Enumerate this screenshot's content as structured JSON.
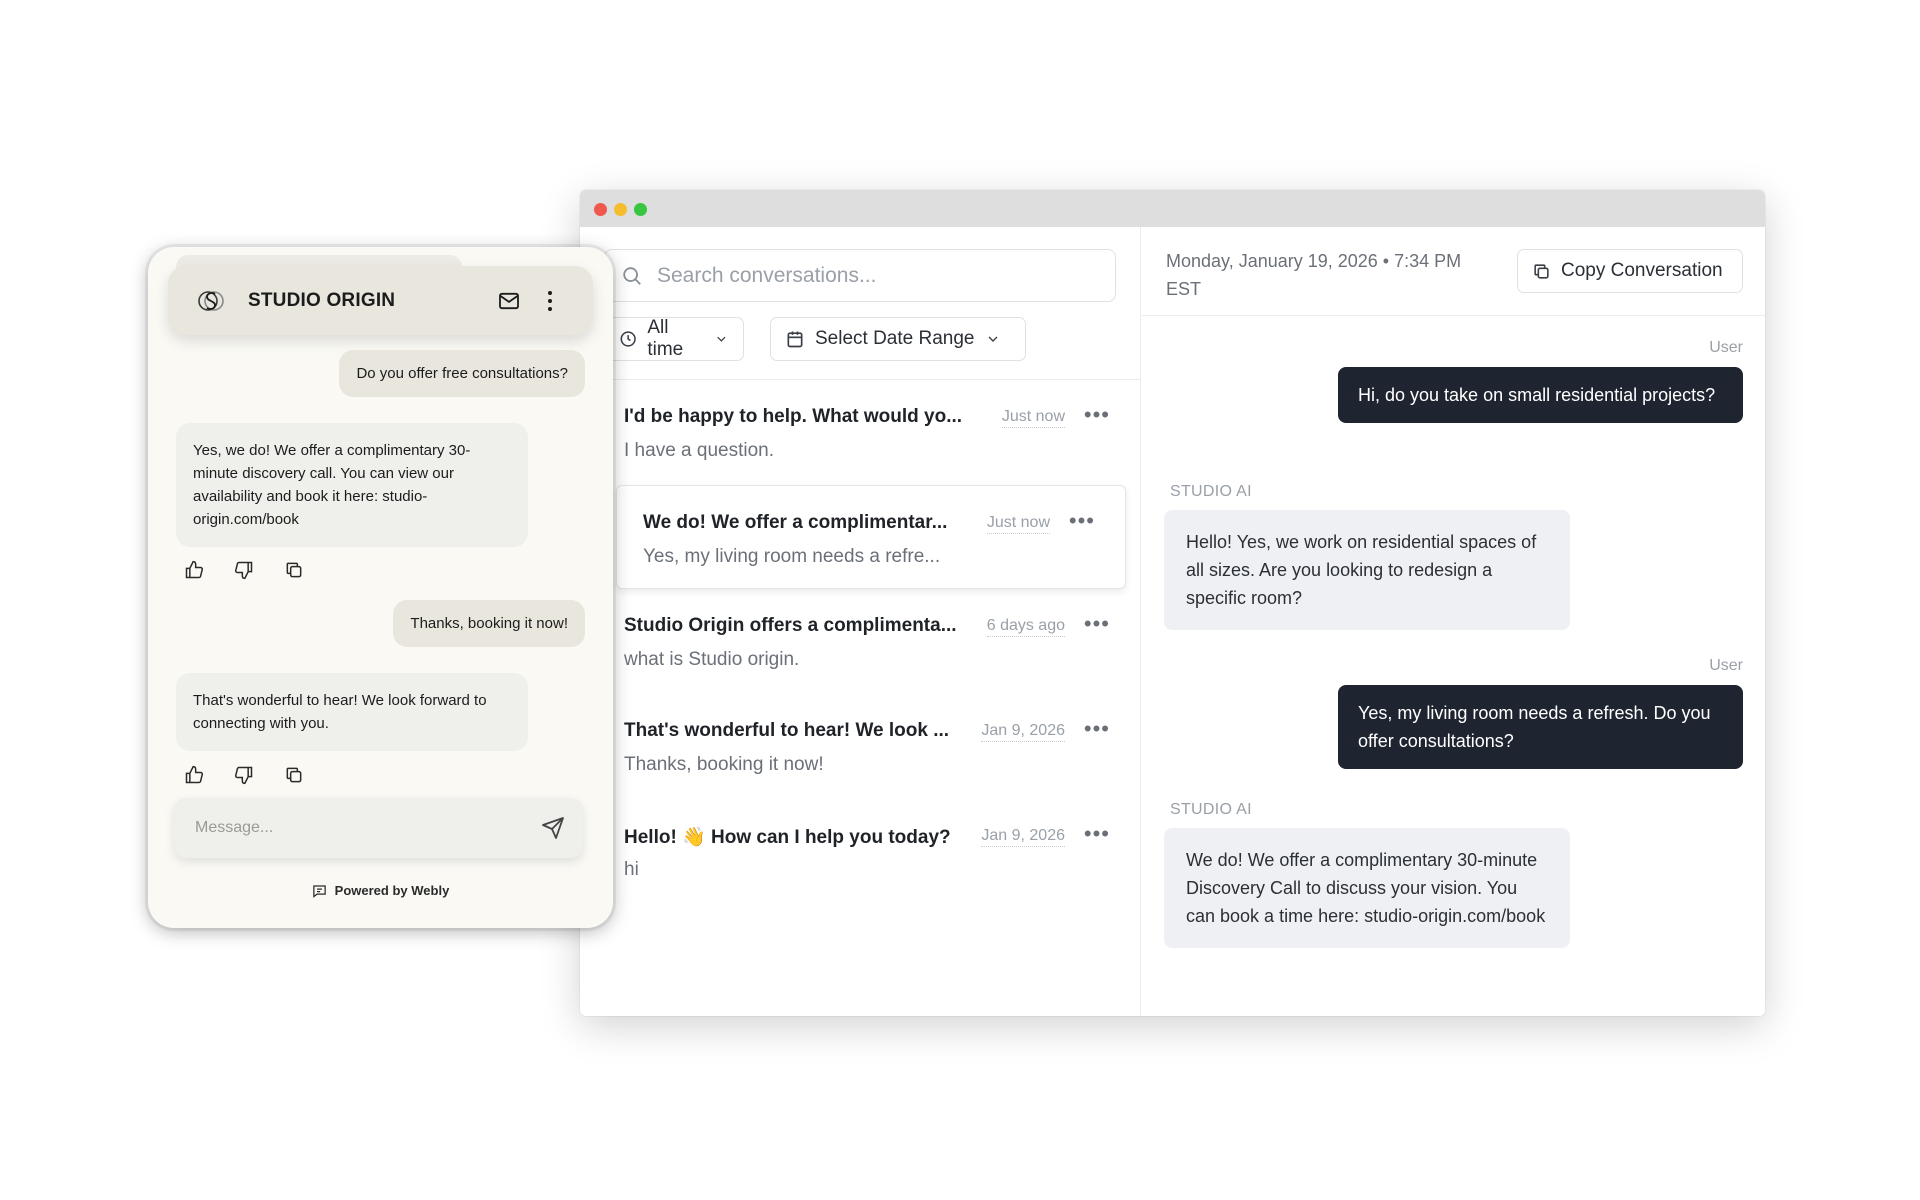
{
  "window": {
    "search": {
      "placeholder": "Search conversations..."
    },
    "filters": {
      "time_label": "All time",
      "date_range_label": "Select Date Range"
    },
    "conversations": [
      {
        "title": "I'd be happy to help. What would yo...",
        "preview": "I have a question.",
        "time": "Just now"
      },
      {
        "title": "We do! We offer a complimentar...",
        "preview": "Yes, my living room needs a refre...",
        "time": "Just now",
        "selected": true
      },
      {
        "title": "Studio Origin offers a complimenta...",
        "preview": "what is Studio origin.",
        "time": "6 days ago"
      },
      {
        "title": "That's wonderful to hear! We look ...",
        "preview": "Thanks, booking it now!",
        "time": "Jan 9, 2026"
      },
      {
        "title": "Hello! 👋 How can I help you today?",
        "preview": "hi",
        "time": "Jan 9, 2026"
      }
    ],
    "detail": {
      "date_line1": "Monday, January 19, 2026 • 7:34 PM",
      "date_line2": "EST",
      "copy_label": "Copy Conversation",
      "messages": [
        {
          "role": "User",
          "text": "Hi, do you take on small residential projects?"
        },
        {
          "role": "STUDIO AI",
          "text": "Hello! Yes, we work on residential spaces of all sizes. Are you looking to redesign a specific room?"
        },
        {
          "role": "User",
          "text": "Yes, my living room needs a refresh. Do you offer consultations?"
        },
        {
          "role": "STUDIO AI",
          "text": "We do! We offer a complimentary 30-minute Discovery Call to discuss your vision. You can book a time here: studio-origin.com/book"
        }
      ]
    }
  },
  "widget": {
    "brand": "STUDIO ORIGIN",
    "messages": [
      {
        "from": "user",
        "text": "Do you offer free consultations?"
      },
      {
        "from": "bot",
        "text": "Yes, we do! We offer a complimentary 30-minute discovery call. You can view our availability and book it here: studio-origin.com/book"
      },
      {
        "from": "user",
        "text": "Thanks, booking it now!"
      },
      {
        "from": "bot",
        "text": "That's wonderful to hear! We look forward to connecting with you."
      }
    ],
    "input_placeholder": "Message...",
    "powered_by": "Powered by Webly"
  },
  "colors": {
    "user_bubble_dark": "#1f2530",
    "ai_bubble": "#eef0f4",
    "widget_bg": "#faf9f4",
    "widget_header": "#e8e6dd",
    "traffic_red": "#f0574d",
    "traffic_yellow": "#f5bc2e",
    "traffic_green": "#37c542"
  },
  "icons": [
    "search-icon",
    "clock-icon",
    "chevron-down-icon",
    "calendar-icon",
    "more-icon",
    "copy-icon",
    "logo-icon",
    "mail-icon",
    "kebab-icon",
    "thumbs-up-icon",
    "thumbs-down-icon",
    "send-icon",
    "chat-icon"
  ]
}
